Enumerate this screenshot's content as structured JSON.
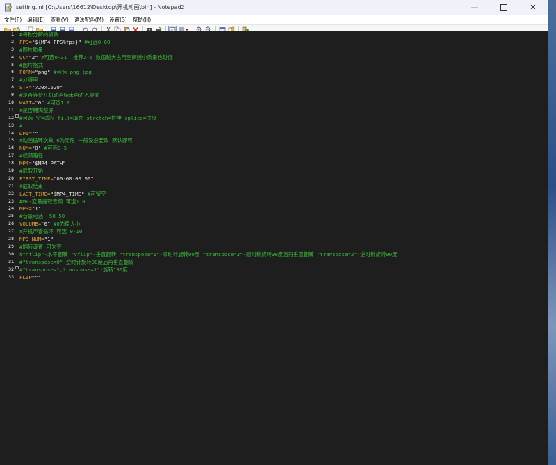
{
  "window": {
    "title": "setting.ini [C:\\Users\\16612\\Desktop\\开机动画\\bin] - Notepad2"
  },
  "menu": [
    {
      "label": "文件(F)"
    },
    {
      "label": "编辑(E)"
    },
    {
      "label": "查看(V)"
    },
    {
      "label": "语法配色(M)"
    },
    {
      "label": "设置(S)"
    },
    {
      "label": "帮助(H)"
    }
  ],
  "colors": {
    "editor_bg": "#1e1e1e",
    "comment": "#3bba3b",
    "key": "#d8a23a",
    "value": "#e8e8e8"
  },
  "lines": [
    {
      "num": "1",
      "comment": "#每秒分解的帧数",
      "key": "",
      "value": "",
      "trail": ""
    },
    {
      "num": "2",
      "comment": "",
      "key": "FPS=",
      "value": "\"${MP4_FPS%fps}\"",
      "trail": " #可选0-60"
    },
    {
      "num": "3",
      "comment": "#图片质量",
      "key": "",
      "value": "",
      "trail": ""
    },
    {
      "num": "4",
      "comment": "",
      "key": "QC=",
      "value": "\"2\"",
      "trail": " #可选0-31  推荐2-5 数值越大占用空间越小质量也越低"
    },
    {
      "num": "5",
      "comment": "#图片格式",
      "key": "",
      "value": "",
      "trail": ""
    },
    {
      "num": "6",
      "comment": "",
      "key": "FORM=",
      "value": "\"png\"",
      "trail": " #可选 png jpg"
    },
    {
      "num": "7",
      "comment": "#分辨率",
      "key": "",
      "value": "",
      "trail": ""
    },
    {
      "num": "8",
      "comment": "",
      "key": "STR=",
      "value": "\"720x1520\"",
      "trail": ""
    },
    {
      "num": "9",
      "comment": "#是否等待开机动画结束再进入桌面",
      "key": "",
      "value": "",
      "trail": ""
    },
    {
      "num": "10",
      "comment": "",
      "key": "WAIT=",
      "value": "\"0\"",
      "trail": " #可选1 0"
    },
    {
      "num": "11",
      "comment": "#是否铺满整屏",
      "key": "",
      "value": "",
      "trail": ""
    },
    {
      "num": "12",
      "comment": "#可选 空=适应 fill=填充 stretch=拉伸 splice=拼接",
      "key": "",
      "value": "",
      "trail": ""
    },
    {
      "num": "13",
      "comment": "#",
      "key": "",
      "value": "",
      "trail": ""
    },
    {
      "num": "14",
      "comment": "",
      "key": "DPI=",
      "value": "\"\"",
      "trail": ""
    },
    {
      "num": "15",
      "comment": "#动画循环次数 0为无限 一般没必要改 默认即可",
      "key": "",
      "value": "",
      "trail": ""
    },
    {
      "num": "16",
      "comment": "",
      "key": "NUM=",
      "value": "\"0\"",
      "trail": " #可选0-5"
    },
    {
      "num": "17",
      "comment": "#视频路径",
      "key": "",
      "value": "",
      "trail": ""
    },
    {
      "num": "18",
      "comment": "",
      "key": "MP4=",
      "value": "\"$MP4_PATH\"",
      "trail": ""
    },
    {
      "num": "19",
      "comment": "#截取开始",
      "key": "",
      "value": "",
      "trail": ""
    },
    {
      "num": "20",
      "comment": "",
      "key": "FIRST_TIME=",
      "value": "\"00:00:00.00\"",
      "trail": ""
    },
    {
      "num": "21",
      "comment": "#截取结束",
      "key": "",
      "value": "",
      "trail": ""
    },
    {
      "num": "22",
      "comment": "",
      "key": "LAST_TIME=",
      "value": "\"$MP4_TIME\"",
      "trail": " #可留空"
    },
    {
      "num": "23",
      "comment": "#MP3変量提取音频 可选1 0",
      "key": "",
      "value": "",
      "trail": ""
    },
    {
      "num": "24",
      "comment": "",
      "key": "MP3=",
      "value": "\"1\"",
      "trail": ""
    },
    {
      "num": "25",
      "comment": "#音量可选 -50~50",
      "key": "",
      "value": "",
      "trail": ""
    },
    {
      "num": "26",
      "comment": "",
      "key": "VOLUME=",
      "value": "\"0\"",
      "trail": " #0为原大小"
    },
    {
      "num": "27",
      "comment": "#开机声音循环 可选 0-10",
      "key": "",
      "value": "",
      "trail": ""
    },
    {
      "num": "28",
      "comment": "",
      "key": "MP3_NUM=",
      "value": "\"1\"",
      "trail": ""
    },
    {
      "num": "29",
      "comment": "#翻转设置 可为空",
      "key": "",
      "value": "",
      "trail": ""
    },
    {
      "num": "30",
      "comment": "#\"hflip\"-水平翻转 \"vflip\"-垂直翻转 \"transpose=1\"-顺时针旋转90度 \"transpose=3\"-顺时针旋转90度后再垂直翻转 \"transpose=2\"-逆时针旋转90度",
      "key": "",
      "value": "",
      "trail": ""
    },
    {
      "num": "31",
      "comment": "#\"transpose=0\"-逆时针旋转90度后再垂直翻转",
      "key": "",
      "value": "",
      "trail": ""
    },
    {
      "num": "32",
      "comment": "#\"transpose=1,transpose=1\"-旋转180度",
      "key": "",
      "value": "",
      "trail": ""
    },
    {
      "num": "33",
      "comment": "",
      "key": "FLIP=",
      "value": "\"\"",
      "trail": ""
    }
  ]
}
